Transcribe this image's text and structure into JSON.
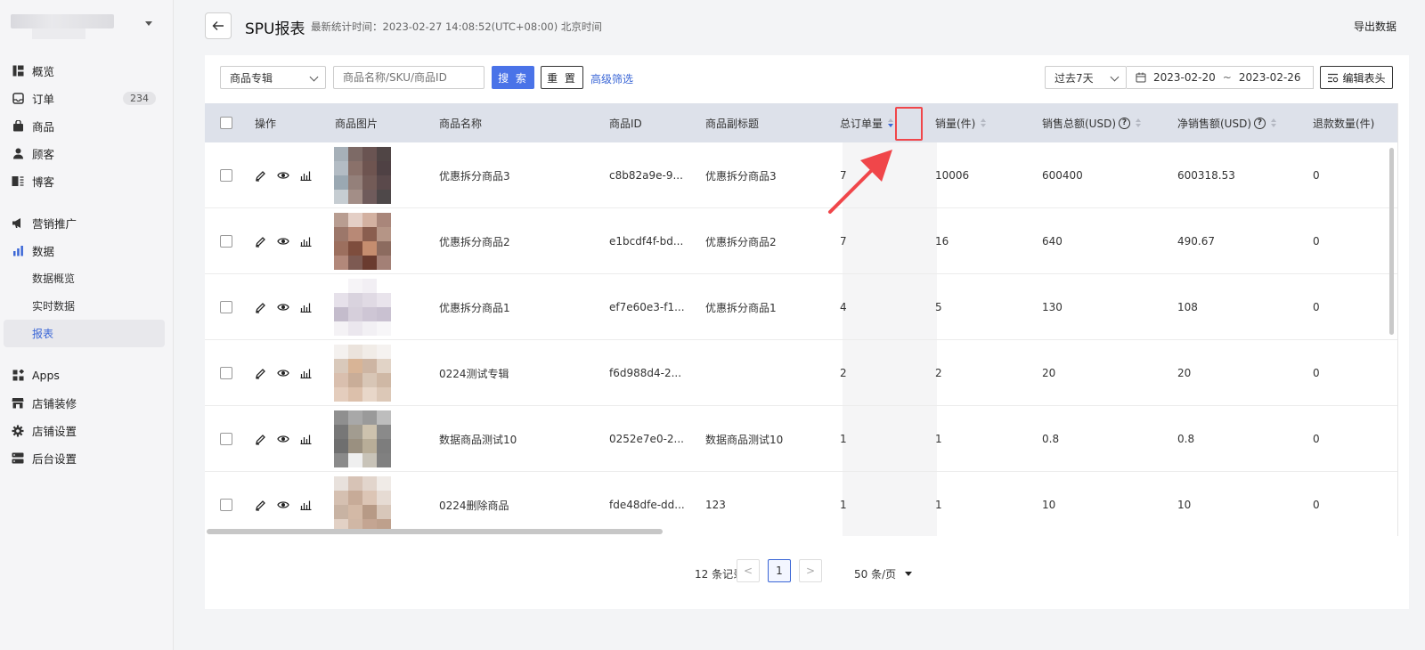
{
  "sidebar": {
    "nav": [
      {
        "label": "概览",
        "icon": "overview-icon"
      },
      {
        "label": "订单",
        "icon": "order-inbox-icon",
        "badge": "234"
      },
      {
        "label": "商品",
        "icon": "shopping-bag-icon"
      },
      {
        "label": "顾客",
        "icon": "user-icon"
      },
      {
        "label": "博客",
        "icon": "blog-icon"
      },
      {
        "label": "营销推广",
        "icon": "megaphone-icon"
      },
      {
        "label": "数据",
        "icon": "bar-chart-icon"
      },
      {
        "label": "Apps",
        "icon": "apps-grid-icon"
      },
      {
        "label": "店铺装修",
        "icon": "storefront-icon"
      },
      {
        "label": "店铺设置",
        "icon": "gear-icon"
      },
      {
        "label": "后台设置",
        "icon": "server-icon"
      }
    ],
    "data_sub": [
      {
        "label": "数据概览"
      },
      {
        "label": "实时数据"
      },
      {
        "label": "报表",
        "active": true
      }
    ]
  },
  "header": {
    "title": "SPU报表",
    "stat_time": "最新统计时间：2023-02-27 14:08:52(UTC+08:00) 北京时间",
    "export_label": "导出数据"
  },
  "filters": {
    "album_select": "商品专辑",
    "search_placeholder": "商品名称/SKU/商品ID",
    "search_label": "搜 索",
    "reset_label": "重 置",
    "advanced_label": "高级筛选",
    "range_select": "过去7天",
    "date_start": "2023-02-20",
    "date_sep": "~",
    "date_end": "2023-02-26",
    "edit_columns_label": "编辑表头"
  },
  "table": {
    "columns": {
      "ops": "操作",
      "image": "商品图片",
      "name": "商品名称",
      "id": "商品ID",
      "subtitle": "商品副标题",
      "orders": "总订单量",
      "qty": "销量(件)",
      "sales": "销售总额(USD)",
      "net": "净销售额(USD)",
      "refund": "退款数量(件)"
    },
    "rows": [
      {
        "name": "优惠拆分商品3",
        "id": "c8b82a9e-9...",
        "subtitle": "优惠拆分商品3",
        "orders": "7",
        "qty": "10006",
        "sales": "600400",
        "net": "600318.53",
        "refund": "0"
      },
      {
        "name": "优惠拆分商品2",
        "id": "e1bcdf4f-bd...",
        "subtitle": "优惠拆分商品2",
        "orders": "7",
        "qty": "16",
        "sales": "640",
        "net": "490.67",
        "refund": "0"
      },
      {
        "name": "优惠拆分商品1",
        "id": "ef7e60e3-f1...",
        "subtitle": "优惠拆分商品1",
        "orders": "4",
        "qty": "5",
        "sales": "130",
        "net": "108",
        "refund": "0"
      },
      {
        "name": "0224测试专辑",
        "id": "f6d988d4-2...",
        "subtitle": "",
        "orders": "2",
        "qty": "2",
        "sales": "20",
        "net": "20",
        "refund": "0"
      },
      {
        "name": "数据商品测试10",
        "id": "0252e7e0-2...",
        "subtitle": "数据商品测试10",
        "orders": "1",
        "qty": "1",
        "sales": "0.8",
        "net": "0.8",
        "refund": "0"
      },
      {
        "name": "0224删除商品",
        "id": "fde48dfe-dd...",
        "subtitle": "123",
        "orders": "1",
        "qty": "1",
        "sales": "10",
        "net": "10",
        "refund": "0"
      }
    ]
  },
  "pager": {
    "total": "12 条记录",
    "prev": "<",
    "current": "1",
    "next": ">",
    "page_size": "50 条/页"
  },
  "colors": {
    "primary": "#4a73e8",
    "link": "#3a66d6",
    "annotation": "#f0464a",
    "header_bg": "#dde1ea"
  }
}
